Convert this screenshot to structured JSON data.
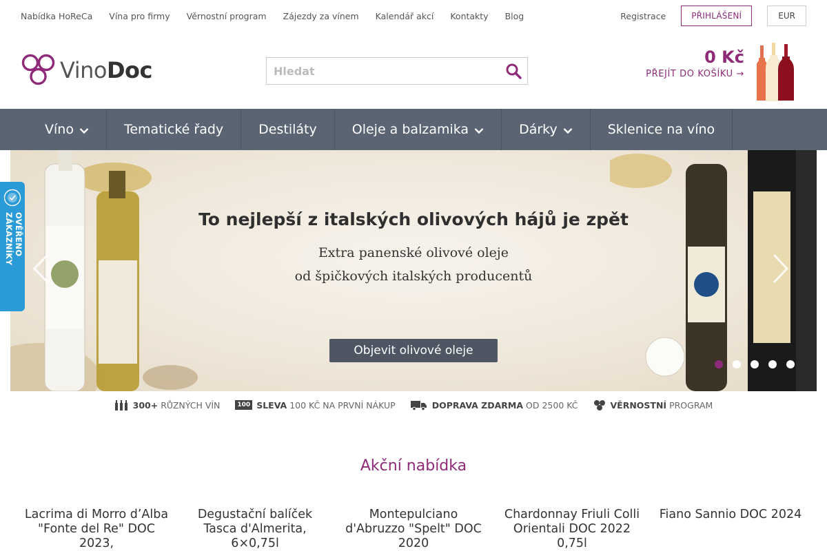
{
  "topbar": {
    "links": [
      "Nabídka HoReCa",
      "Vína pro firmy",
      "Věrnostní program",
      "Zájezdy za vínem",
      "Kalendář akcí",
      "Kontakty",
      "Blog"
    ],
    "register": "Registrace",
    "login": "PŘIHLÁŠENÍ",
    "currency": "EUR"
  },
  "logo": {
    "part1": "Vino",
    "part2": "Doc"
  },
  "search": {
    "placeholder": "Hledat"
  },
  "cart": {
    "total": "0 Kč",
    "link": "PŘEJÍT DO KOŠÍKU →"
  },
  "nav": [
    {
      "label": "Víno",
      "dropdown": true
    },
    {
      "label": "Tematické řady",
      "dropdown": false
    },
    {
      "label": "Destiláty",
      "dropdown": false
    },
    {
      "label": "Oleje a balzamika",
      "dropdown": true
    },
    {
      "label": "Dárky",
      "dropdown": true
    },
    {
      "label": "Sklenice na víno",
      "dropdown": false
    }
  ],
  "banner": {
    "title": "To nejlepší z italských olivových hájů je zpět",
    "sub1": "Extra panenské olivové oleje",
    "sub2": "od špičkových italských producentů",
    "cta": "Objevit olivové oleje",
    "slides": 5,
    "active_slide": 1
  },
  "verified": {
    "text": "OVĚŘENO ZÁKAZNÍKY"
  },
  "benefits": [
    {
      "icon": "bottles-icon",
      "bold": "300+",
      "text": "RŮZNÝCH VÍN"
    },
    {
      "icon": "discount-100-icon",
      "badge": "100",
      "bold": "SLEVA",
      "text": "100 KČ NA PRVNÍ NÁKUP"
    },
    {
      "icon": "truck-icon",
      "bold": "DOPRAVA ZDARMA",
      "text": "OD 2500 KČ"
    },
    {
      "icon": "loyalty-icon",
      "bold": "VĚRNOSTNÍ",
      "text": "PROGRAM"
    }
  ],
  "offers": {
    "title": "Akční nabídka",
    "products": [
      "Lacrima di Morro d’Alba \"Fonte del Re\" DOC 2023,",
      "Degustační balíček Tasca d'Almerita, 6×0,75l",
      "Montepulciano d'Abruzzo \"Spelt\" DOC 2020",
      "Chardonnay Friuli Colli Orientali DOC 2022 0,75l",
      "Fiano Sannio DOC 2024"
    ]
  },
  "colors": {
    "brand": "#8e2a78",
    "nav": "#5a6472",
    "verified": "#2a9bd6"
  }
}
